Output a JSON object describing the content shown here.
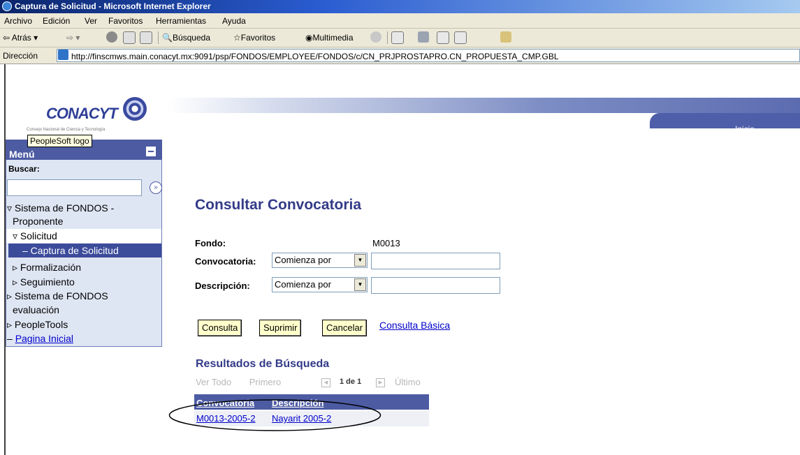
{
  "window": {
    "title": "Captura de Solicitud - Microsoft Internet Explorer"
  },
  "menubar": [
    "Archivo",
    "Edición",
    "Ver",
    "Favoritos",
    "Herramientas",
    "Ayuda"
  ],
  "toolbar": {
    "back": "Atrás",
    "search": "Búsqueda",
    "favorites": "Favoritos",
    "media": "Multimedia"
  },
  "address": {
    "label": "Dirección",
    "url": "http://finscmws.main.conacyt.mx:9091/psp/FONDOS/EMPLOYEE/FONDOS/c/CN_PRJPROSTAPRO.CN_PROPUESTA_CMP.GBL"
  },
  "header": {
    "logo": "CONACYT",
    "logo_sub": "Consejo Nacional de Ciencia y Tecnología",
    "tooltip": "PeopleSoft logo",
    "home_link": "Inicio"
  },
  "menu": {
    "title": "Menú",
    "search_label": "Buscar:",
    "search_value": "",
    "items": [
      {
        "label": "Sistema de FONDOS -",
        "cont": "Proponente"
      },
      {
        "label": "Solicitud"
      },
      {
        "label": "– Captura de Solicitud"
      },
      {
        "label": "Formalización"
      },
      {
        "label": "Seguimiento"
      },
      {
        "label": "Sistema de FONDOS",
        "cont": "evaluación"
      },
      {
        "label": "PeopleTools"
      },
      {
        "label": "Pagina Inicial"
      }
    ]
  },
  "form": {
    "title": "Consultar Convocatoria",
    "fondo_label": "Fondo:",
    "fondo_value": "M0013",
    "convocatoria_label": "Convocatoria:",
    "descripcion_label": "Descripción:",
    "operator": "Comienza por",
    "convocatoria_value": "",
    "descripcion_value": ""
  },
  "buttons": {
    "consulta": "Consulta",
    "suprimir": "Suprimir",
    "cancelar": "Cancelar",
    "basic": "Consulta Básica"
  },
  "results": {
    "title": "Resultados de Búsqueda",
    "view_all": "Ver Todo",
    "first": "Primero",
    "count": "1 de 1",
    "last": "Último",
    "columns": [
      "Convocatoria",
      "Descripción"
    ],
    "rows": [
      {
        "convocatoria": "M0013-2005-2",
        "descripcion": "Nayarit 2005-2"
      }
    ]
  }
}
